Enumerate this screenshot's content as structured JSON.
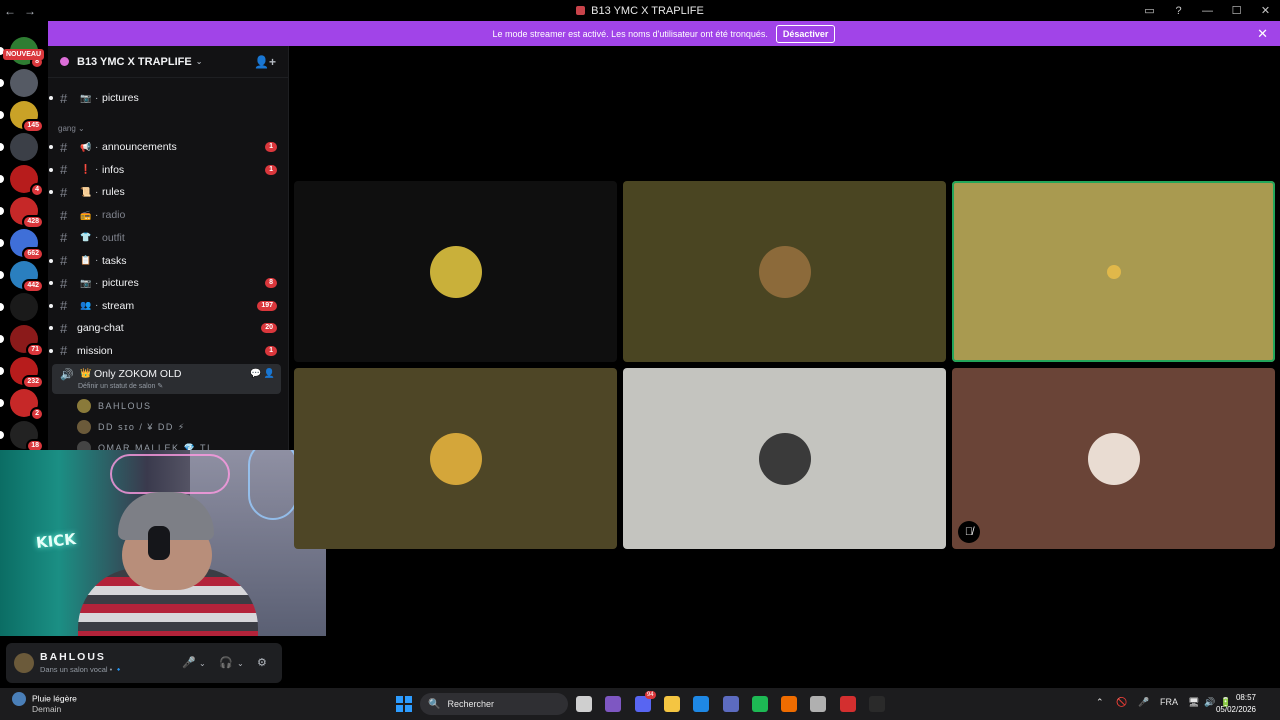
{
  "window": {
    "title": "B13 YMC X TRAPLIFE",
    "nav_back": "←",
    "nav_forward": "→",
    "controls": [
      "▭",
      "?",
      "—",
      "☐",
      "✕"
    ]
  },
  "rail": {
    "nouveau_label": "NOUVEAU",
    "servers": [
      {
        "color": "#2e7d32",
        "badge": "8"
      },
      {
        "color": "#555a64",
        "badge": ""
      },
      {
        "color": "#c9a227",
        "badge": "145"
      },
      {
        "color": "#3b3f47",
        "badge": ""
      },
      {
        "color": "#b71c1c",
        "badge": "4"
      },
      {
        "color": "#c62828",
        "badge": "428"
      },
      {
        "color": "#3f6fd8",
        "badge": "662"
      },
      {
        "color": "#2a7fbf",
        "badge": "442"
      },
      {
        "color": "#1a1a1a",
        "badge": ""
      },
      {
        "color": "#8b1a1a",
        "badge": "71"
      },
      {
        "color": "#b71c1c",
        "badge": "232"
      },
      {
        "color": "#c62828",
        "badge": "2"
      },
      {
        "color": "#222",
        "badge": "18"
      }
    ]
  },
  "banner": {
    "text": "Le mode streamer est activé. Les noms d'utilisateur ont été tronqués.",
    "button": "Désactiver",
    "close": "✕"
  },
  "server_header": {
    "name": "B13 YMC X TRAPLIFE",
    "chevron": "⌄",
    "invite": "👤+"
  },
  "channels": {
    "top": {
      "emoji": "📷",
      "name": "pictures"
    },
    "category": "gang",
    "list": [
      {
        "emoji": "📢",
        "name": "announcements",
        "badge": "1",
        "muted": false
      },
      {
        "emoji": "❗",
        "name": "infos",
        "badge": "1",
        "muted": false
      },
      {
        "emoji": "📜",
        "name": "rules",
        "badge": "",
        "muted": false
      },
      {
        "emoji": "📻",
        "name": "radio",
        "badge": "",
        "muted": true
      },
      {
        "emoji": "👕",
        "name": "outfit",
        "badge": "",
        "muted": true
      },
      {
        "emoji": "📋",
        "name": "tasks",
        "badge": "",
        "muted": false
      },
      {
        "emoji": "📷",
        "name": "pictures",
        "badge": "8",
        "muted": false
      },
      {
        "emoji": "👥",
        "name": "stream",
        "badge": "197",
        "muted": false
      }
    ],
    "plain": [
      {
        "name": "gang-chat",
        "badge": "20"
      },
      {
        "name": "mission",
        "badge": "1"
      }
    ]
  },
  "voice_channel": {
    "speaker_icon": "🔊",
    "crown": "👑",
    "name": "Only ZOKOM OLD",
    "status": "Définir un statut de salon ✎",
    "icons": "💬 👤",
    "members": [
      {
        "name": "BAHLOUS",
        "color": "#8a7a3a"
      },
      {
        "name": "DD ꜱɪᴏ  /  ¥ DD ⚡",
        "color": "#6b5a3a"
      },
      {
        "name": "OMAR MALLEK 💎 TI",
        "color": "#444"
      }
    ]
  },
  "webcam": {
    "sign": "KICK"
  },
  "user_panel": {
    "name": "BAHLOUS",
    "status": "Dans un salon vocal • 🔹",
    "mic": "🎤",
    "headset": "🎧",
    "chev": "⌄",
    "settings": "⚙"
  },
  "tiles": [
    {
      "bg": "#0f0f0f",
      "avatar": "#c9b03a",
      "speaking": false,
      "muted": false
    },
    {
      "bg": "#4a4522",
      "avatar": "#8c6a3a",
      "speaking": false,
      "muted": false
    },
    {
      "bg": "#a99a50",
      "avatar": "#a99a50",
      "speaking": true,
      "muted": false
    },
    {
      "bg": "#4e4626",
      "avatar": "#d4a63a",
      "speaking": false,
      "muted": false
    },
    {
      "bg": "#c4c4bf",
      "avatar": "#3a3a3a",
      "speaking": false,
      "muted": false
    },
    {
      "bg": "#6a4437",
      "avatar": "#e9dcd2",
      "speaking": false,
      "muted": true
    }
  ],
  "mute_icon": "🎙̸",
  "taskbar": {
    "weather_title": "Pluie légère",
    "weather_sub": "Demain",
    "search_placeholder": "Rechercher",
    "search_icon": "🔍",
    "apps": [
      {
        "color": "#cfcfcf",
        "badge": ""
      },
      {
        "color": "#7e57c2",
        "badge": ""
      },
      {
        "color": "#5865f2",
        "badge": "94"
      },
      {
        "color": "#f4c542",
        "badge": ""
      },
      {
        "color": "#1e88e5",
        "badge": ""
      },
      {
        "color": "#5c6bc0",
        "badge": ""
      },
      {
        "color": "#1db954",
        "badge": ""
      },
      {
        "color": "#ef6c00",
        "badge": ""
      },
      {
        "color": "#b0b0b0",
        "badge": ""
      },
      {
        "color": "#d32f2f",
        "badge": ""
      },
      {
        "color": "#2a2a2a",
        "badge": ""
      }
    ],
    "tray": [
      "⌃",
      "🚫",
      "🎤",
      "FRA",
      "🖥",
      "🔊",
      "🔋"
    ],
    "time": "08:57",
    "date": "05/02/2026"
  }
}
